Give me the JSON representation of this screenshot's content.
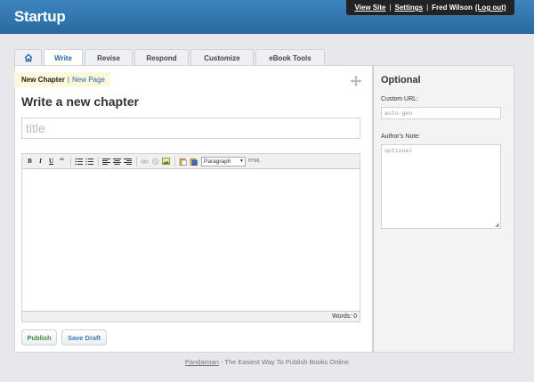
{
  "app": {
    "title": "Startup"
  },
  "usernav": {
    "view_site": "View Site",
    "settings": "Settings",
    "user_name": "Fred Wilson",
    "logout": "(Log out)",
    "separator": "|"
  },
  "tabs": [
    {
      "label": "",
      "icon": "home-icon"
    },
    {
      "label": "Write",
      "active": true
    },
    {
      "label": "Revise"
    },
    {
      "label": "Respond"
    },
    {
      "label": "Customize"
    },
    {
      "label": "eBook Tools"
    }
  ],
  "subtabs": {
    "current": "New Chapter",
    "separator": "|",
    "new_page": "New Page"
  },
  "page": {
    "heading": "Write a new chapter"
  },
  "title_field": {
    "placeholder": "title",
    "value": ""
  },
  "editor": {
    "toolbar": {
      "bold": "B",
      "italic": "I",
      "underline": "U",
      "quote": "“",
      "format_value": "Paragraph",
      "html": "HTML"
    },
    "status": "Words: 0"
  },
  "actions": {
    "publish": "Publish",
    "save_draft": "Save Draft"
  },
  "sidebar": {
    "title": "Optional",
    "custom_url_label": "Custom URL:",
    "custom_url_placeholder": "auto-gen",
    "authors_note_label": "Author's Note:",
    "authors_note_placeholder": "optional"
  },
  "footer": {
    "link": "Pandamian",
    "tagline": " - The Easiest Way To Publish Books Online"
  },
  "colors": {
    "header": "#2a6aa3",
    "accent": "#3b7fb8",
    "publish": "#3a8a3a",
    "highlight": "#fbf8dc"
  }
}
